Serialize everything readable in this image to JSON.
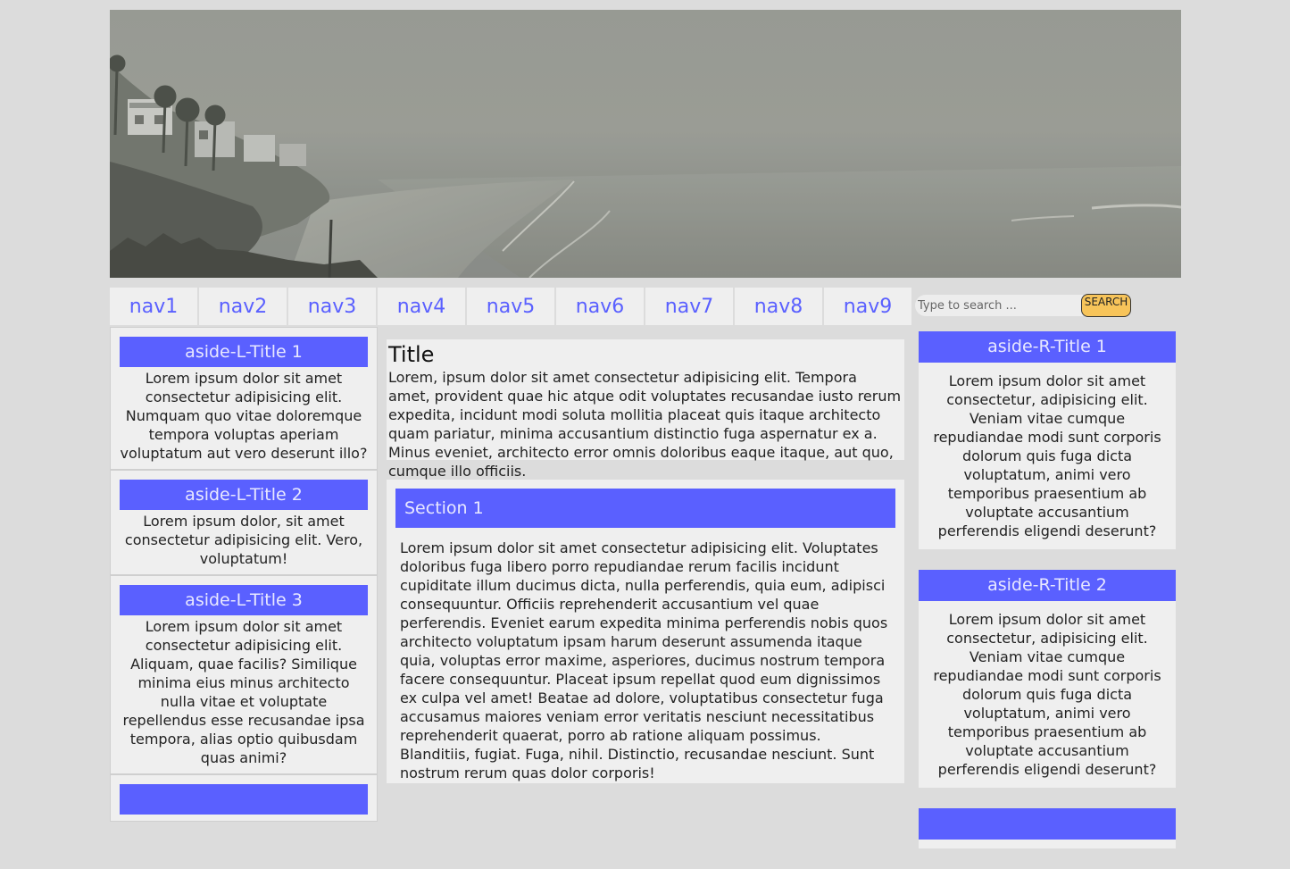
{
  "nav": [
    "nav1",
    "nav2",
    "nav3",
    "nav4",
    "nav5",
    "nav6",
    "nav7",
    "nav8",
    "nav9"
  ],
  "search": {
    "placeholder": "Type to search ...",
    "button": "SEARCH"
  },
  "aside_left": [
    {
      "title": "aside-L-Title 1",
      "text": "Lorem ipsum dolor sit amet consectetur adipisicing elit. Numquam quo vitae doloremque tempora voluptas aperiam voluptatum aut vero deserunt illo?"
    },
    {
      "title": "aside-L-Title 2",
      "text": "Lorem ipsum dolor, sit amet consectetur adipisicing elit. Vero, voluptatum!"
    },
    {
      "title": "aside-L-Title 3",
      "text": "Lorem ipsum dolor sit amet consectetur adipisicing elit. Aliquam, quae facilis? Similique minima eius minus architecto nulla vitae et voluptate repellendus esse recusandae ipsa tempora, alias optio quibusdam quas animi?"
    }
  ],
  "main": {
    "title": "Title",
    "intro": "Lorem, ipsum dolor sit amet consectetur adipisicing elit. Tempora amet, provident quae hic atque odit voluptates recusandae iusto rerum expedita, incidunt modi soluta mollitia placeat quis itaque architecto quam pariatur, minima accusantium distinctio fuga aspernatur ex a. Minus eveniet, architecto error omnis doloribus eaque itaque, aut quo, cumque illo officiis.",
    "section": {
      "title": "Section 1",
      "text": "Lorem ipsum dolor sit amet consectetur adipisicing elit. Voluptates doloribus fuga libero porro repudiandae rerum facilis incidunt cupiditate illum ducimus dicta, nulla perferendis, quia eum, adipisci consequuntur. Officiis reprehenderit accusantium vel quae perferendis. Eveniet earum expedita minima perferendis nobis quos architecto voluptatum ipsam harum deserunt assumenda itaque quia, voluptas error maxime, asperiores, ducimus nostrum tempora facere consequuntur. Placeat ipsum repellat quod eum dignissimos ex culpa vel amet! Beatae ad dolore, voluptatibus consectetur fuga accusamus maiores veniam error veritatis nesciunt necessitatibus reprehenderit quaerat, porro ab ratione aliquam possimus. Blanditiis, fugiat. Fuga, nihil. Distinctio, recusandae nesciunt. Sunt nostrum rerum quas dolor corporis!"
    }
  },
  "aside_right": [
    {
      "title": "aside-R-Title 1",
      "text": "Lorem ipsum dolor sit amet consectetur, adipisicing elit. Veniam vitae cumque repudiandae modi sunt corporis dolorum quis fuga dicta voluptatum, animi vero temporibus praesentium ab voluptate accusantium perferendis eligendi deserunt?"
    },
    {
      "title": "aside-R-Title 2",
      "text": "Lorem ipsum dolor sit amet consectetur, adipisicing elit. Veniam vitae cumque repudiandae modi sunt corporis dolorum quis fuga dicta voluptatum, animi vero temporibus praesentium ab voluptate accusantium perferendis eligendi deserunt?"
    }
  ],
  "colors": {
    "accent": "#5a60ff",
    "nav_text": "#5a60ff",
    "panel_bg": "#efefef",
    "page_bg": "#dcdcdc",
    "search_button": "#f7c45a"
  },
  "banner": {
    "image": "grayscale-foggy-beach-photo"
  }
}
